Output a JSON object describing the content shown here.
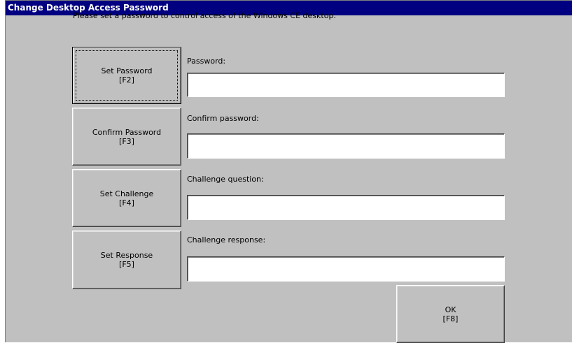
{
  "window": {
    "title": "Change Desktop Access Password",
    "instruction": "Please set a password to control access of the Windows CE desktop."
  },
  "buttons": {
    "set_password": {
      "label": "Set Password",
      "key": "[F2]"
    },
    "confirm_password": {
      "label": "Confirm Password",
      "key": "[F3]"
    },
    "set_challenge": {
      "label": "Set Challenge",
      "key": "[F4]"
    },
    "set_response": {
      "label": "Set Response",
      "key": "[F5]"
    },
    "ok": {
      "label": "OK",
      "key": "[F8]"
    }
  },
  "fields": {
    "password": {
      "label": "Password:",
      "value": ""
    },
    "confirm_password": {
      "label": "Confirm password:",
      "value": ""
    },
    "challenge_question": {
      "label": "Challenge question:",
      "value": ""
    },
    "challenge_response": {
      "label": "Challenge response:",
      "value": ""
    }
  },
  "colors": {
    "titlebar": "#000080",
    "dialog_background": "#c0c0c0",
    "field_background": "#ffffff"
  }
}
